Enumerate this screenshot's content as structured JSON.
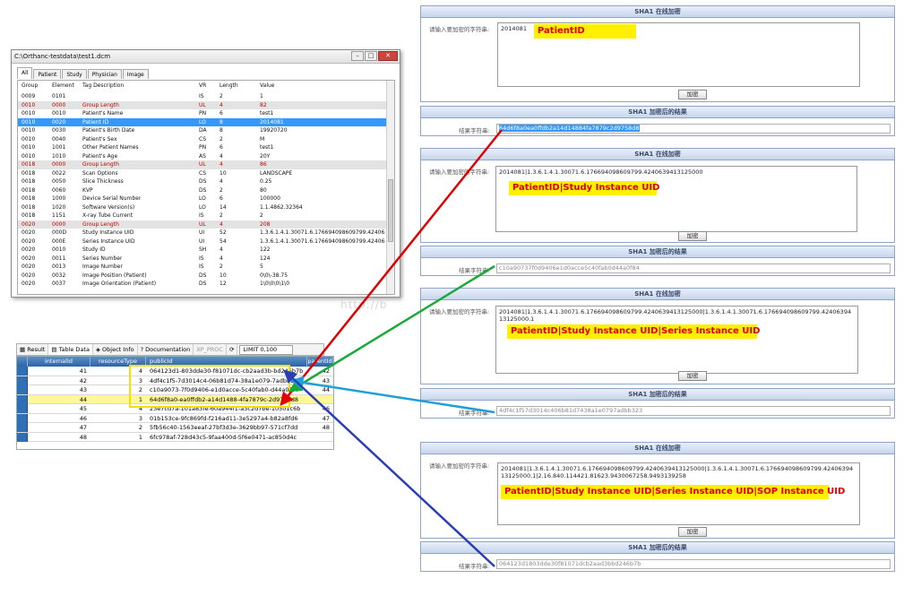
{
  "dicom": {
    "title": "C:\\Orthanc-testdata\\test1.dcm",
    "tabs": [
      "All",
      "Patient",
      "Study",
      "Physician",
      "Image"
    ],
    "columns": [
      "Group",
      "Element",
      "Tag Description",
      "VR",
      "Length",
      "Value"
    ],
    "rows": [
      {
        "g": "0009",
        "e": "0101",
        "d": "",
        "vr": "IS",
        "len": "2",
        "v": "1",
        "style": ""
      },
      {
        "g": "0010",
        "e": "0000",
        "d": "Group Length",
        "vr": "UL",
        "len": "4",
        "v": "82",
        "style": "red"
      },
      {
        "g": "0010",
        "e": "0010",
        "d": "Patient's Name",
        "vr": "PN",
        "len": "6",
        "v": "test1",
        "style": ""
      },
      {
        "g": "0010",
        "e": "0020",
        "d": "Patient ID",
        "vr": "LO",
        "len": "8",
        "v": "2014081",
        "style": "sel"
      },
      {
        "g": "0010",
        "e": "0030",
        "d": "Patient's Birth Date",
        "vr": "DA",
        "len": "8",
        "v": "19920720",
        "style": ""
      },
      {
        "g": "0010",
        "e": "0040",
        "d": "Patient's Sex",
        "vr": "CS",
        "len": "2",
        "v": "M",
        "style": ""
      },
      {
        "g": "0010",
        "e": "1001",
        "d": "Other Patient Names",
        "vr": "PN",
        "len": "6",
        "v": "test1",
        "style": ""
      },
      {
        "g": "0010",
        "e": "1010",
        "d": "Patient's Age",
        "vr": "AS",
        "len": "4",
        "v": "20Y",
        "style": ""
      },
      {
        "g": "0018",
        "e": "0000",
        "d": "Group Length",
        "vr": "UL",
        "len": "4",
        "v": "86",
        "style": "red"
      },
      {
        "g": "0018",
        "e": "0022",
        "d": "Scan Options",
        "vr": "CS",
        "len": "10",
        "v": "LANDSCAPE",
        "style": ""
      },
      {
        "g": "0018",
        "e": "0050",
        "d": "Slice Thickness",
        "vr": "DS",
        "len": "4",
        "v": "0.25",
        "style": ""
      },
      {
        "g": "0018",
        "e": "0060",
        "d": "KVP",
        "vr": "DS",
        "len": "2",
        "v": "80",
        "style": ""
      },
      {
        "g": "0018",
        "e": "1000",
        "d": "Device Serial Number",
        "vr": "LO",
        "len": "6",
        "v": "100000",
        "style": ""
      },
      {
        "g": "0018",
        "e": "1020",
        "d": "Software Version(s)",
        "vr": "LO",
        "len": "14",
        "v": "1.1.4862.32364",
        "style": ""
      },
      {
        "g": "0018",
        "e": "1151",
        "d": "X-ray Tube Current",
        "vr": "IS",
        "len": "2",
        "v": "2",
        "style": ""
      },
      {
        "g": "0020",
        "e": "0000",
        "d": "Group Length",
        "vr": "UL",
        "len": "4",
        "v": "208",
        "style": "red"
      },
      {
        "g": "0020",
        "e": "000D",
        "d": "Study Instance UID",
        "vr": "UI",
        "len": "52",
        "v": "1.3.6.1.4.1.30071.6.176694098609799.424063...",
        "style": ""
      },
      {
        "g": "0020",
        "e": "000E",
        "d": "Series Instance UID",
        "vr": "UI",
        "len": "54",
        "v": "1.3.6.1.4.1.30071.6.176694098609799.424063...",
        "style": ""
      },
      {
        "g": "0020",
        "e": "0010",
        "d": "Study ID",
        "vr": "SH",
        "len": "4",
        "v": "122",
        "style": ""
      },
      {
        "g": "0020",
        "e": "0011",
        "d": "Series Number",
        "vr": "IS",
        "len": "4",
        "v": "124",
        "style": ""
      },
      {
        "g": "0020",
        "e": "0013",
        "d": "Image Number",
        "vr": "IS",
        "len": "2",
        "v": "5",
        "style": ""
      },
      {
        "g": "0020",
        "e": "0032",
        "d": "Image Position (Patient)",
        "vr": "DS",
        "len": "10",
        "v": "0\\0\\-38.75",
        "style": ""
      },
      {
        "g": "0020",
        "e": "0037",
        "d": "Image Orientation (Patient)",
        "vr": "DS",
        "len": "12",
        "v": "1\\0\\0\\0\\1\\0",
        "style": ""
      }
    ]
  },
  "sql": {
    "tabs": [
      "Result",
      "Table Data",
      "Object Info",
      "Documentation",
      "XP_PROC"
    ],
    "limit": "LIMIT 0,100",
    "columns": [
      "internalId",
      "resourceType",
      "publicId",
      "parentId"
    ],
    "rows": [
      {
        "id": "41",
        "type": "4",
        "pub": "064123d1-803dde30-f81071dc-cb2aad3b-bd246b7b",
        "parent": "42"
      },
      {
        "id": "42",
        "type": "3",
        "pub": "4df4c1f5-7d3014c4-06b81d74-38a1e079-7adbb323",
        "parent": "43"
      },
      {
        "id": "43",
        "type": "2",
        "pub": "c10a9073-7f0d9406-e1d0acce-5c40fab0-d44a0f84",
        "parent": "44"
      },
      {
        "id": "44",
        "type": "1",
        "pub": "64d6f8a0-ea0ffdb2-a14d1488-4fa7879c-2d9758d8",
        "parent": ""
      },
      {
        "id": "45",
        "type": "4",
        "pub": "23e7cd7a-101a83fe-60a944f1-a3c2d7be-10501c6b",
        "parent": "46"
      },
      {
        "id": "46",
        "type": "3",
        "pub": "01b153ce-9fc869fd-f216ad11-3e5297a4-b82a8fd6",
        "parent": "47"
      },
      {
        "id": "47",
        "type": "2",
        "pub": "5fb56c40-1563eeaf-27bf3d3e-3629bb97-571cf7dd",
        "parent": "48"
      },
      {
        "id": "48",
        "type": "1",
        "pub": "6fc978af-728d43c5-9faa400d-5f6e0471-ac850d4c",
        "parent": ""
      }
    ]
  },
  "panels": [
    {
      "title": "SHA1 在线加密",
      "label": "请输入要加密的字符串:",
      "input": "2014081",
      "button": "加密",
      "annotation": "PatientID",
      "result_title": "SHA1 加密后的结果",
      "result_label": "结果字符串:",
      "result": "64d6f8a0ea0ffdb2a14d14884fa7879c2d9758d8"
    },
    {
      "title": "SHA1 在线加密",
      "label": "请输入要加密的字符串:",
      "input": "2014081|1.3.6.1.4.1.30071.6.176694098609799.4240639413125000",
      "button": "加密",
      "annotation": "PatientID|Study Instance UID",
      "result_title": "SHA1 加密后的结果",
      "result_label": "结果字符串:",
      "result": "c10a90737f0d9406e1d0acce5c40fab0d44a0f84"
    },
    {
      "title": "SHA1 在线加密",
      "label": "请输入要加密的字符串:",
      "input": "2014081|1.3.6.1.4.1.30071.6.176694098609799.4240639413125000|1.3.6.1.4.1.30071.6.176694098609799.4240639413125000.1",
      "button": "加密",
      "annotation": "PatientID|Study Instance UID|Series Instance UID",
      "result_title": "SHA1 加密后的结果",
      "result_label": "结果字符串:",
      "result": "4df4c1f57d3014c406b81d7438a1e0797adbb323"
    },
    {
      "title": "SHA1 在线加密",
      "label": "请输入要加密的字符串:",
      "input": "2014081|1.3.6.1.4.1.30071.6.176694098609799.4240639413125000|1.3.6.1.4.1.30071.6.176694098609799.4240639413125000.1|2.16.840.114421.81623.9430067258.9493139258",
      "button": "加密",
      "annotation": "PatientID|Study Instance UID|Series Instance UID|SOP Instance UID",
      "result_title": "SHA1 加密后的结果",
      "result_label": "结果字符串:",
      "result": "064123d1803dde30f81071dcb2aad3bbd246b7b"
    }
  ],
  "watermark": "http://b",
  "colors": {
    "red": "#e00000",
    "green": "#1aaa3a",
    "cyan": "#1d9fd8",
    "blue": "#2a3fb5",
    "highlight": "#ffef00"
  }
}
